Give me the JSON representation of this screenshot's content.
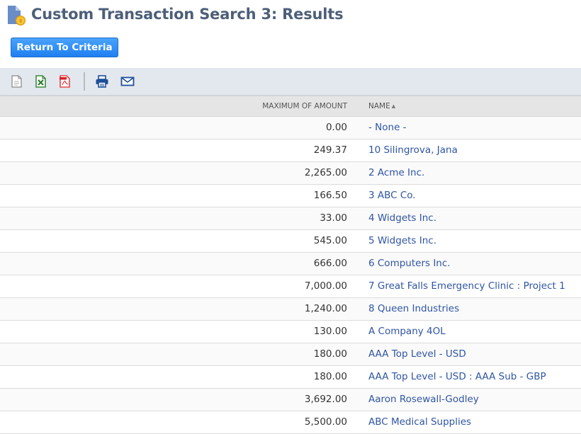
{
  "header": {
    "title": "Custom Transaction Search 3: Results",
    "icon": "saved-search-document-icon"
  },
  "actions": {
    "return_label": "Return To Criteria"
  },
  "toolbar": {
    "icons": [
      "export-csv-icon",
      "export-excel-icon",
      "export-pdf-icon",
      "print-icon",
      "email-icon"
    ]
  },
  "colors": {
    "title": "#4d5f79",
    "button": "#2b8af5",
    "link": "#2f55a4",
    "toolbar_bg": "#e3e7ee",
    "header_bg": "#e5e5e5"
  },
  "table": {
    "columns": [
      {
        "label": "MAXIMUM OF AMOUNT"
      },
      {
        "label": "NAME",
        "sort": "ascending",
        "sort_glyph": "▲"
      }
    ],
    "rows": [
      {
        "amount": "0.00",
        "name": "- None -"
      },
      {
        "amount": "249.37",
        "name": "10 Silingrova, Jana"
      },
      {
        "amount": "2,265.00",
        "name": "2 Acme Inc."
      },
      {
        "amount": "166.50",
        "name": "3 ABC Co."
      },
      {
        "amount": "33.00",
        "name": "4 Widgets Inc."
      },
      {
        "amount": "545.00",
        "name": "5 Widgets Inc."
      },
      {
        "amount": "666.00",
        "name": "6 Computers Inc."
      },
      {
        "amount": "7,000.00",
        "name": "7 Great Falls Emergency Clinic : Project 1"
      },
      {
        "amount": "1,240.00",
        "name": "8 Queen Industries"
      },
      {
        "amount": "130.00",
        "name": "A Company 4OL"
      },
      {
        "amount": "180.00",
        "name": "AAA Top Level - USD"
      },
      {
        "amount": "180.00",
        "name": "AAA Top Level - USD : AAA Sub - GBP"
      },
      {
        "amount": "3,692.00",
        "name": "Aaron Rosewall-Godley"
      },
      {
        "amount": "5,500.00",
        "name": "ABC Medical Supplies"
      }
    ]
  }
}
